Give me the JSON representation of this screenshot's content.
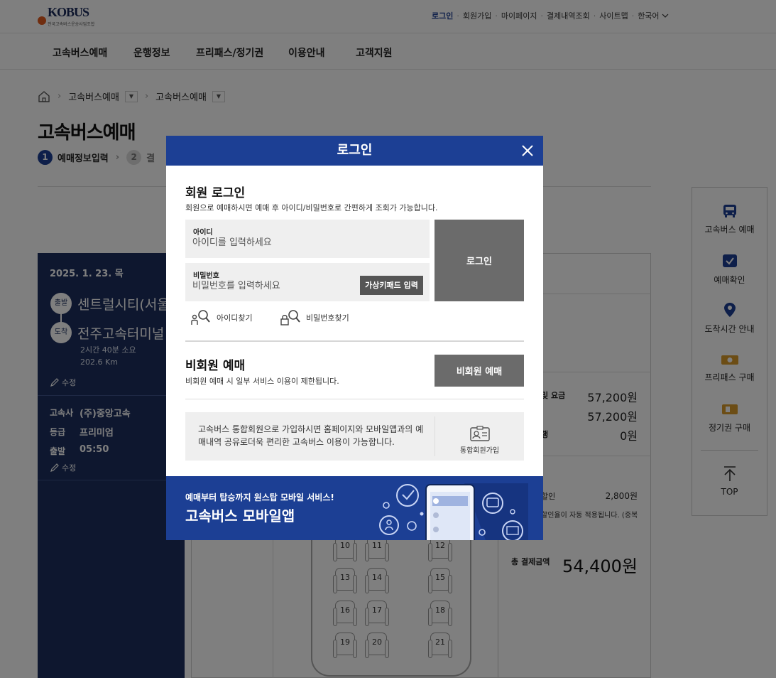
{
  "header": {
    "logo_text": "KOBUS",
    "logo_sub": "전국고속버스운송사업조합",
    "util_links": [
      "로그인",
      "회원가입",
      "마이페이지",
      "결제내역조회",
      "사이트맵",
      "한국어"
    ],
    "nav": [
      "고속버스예매",
      "운행정보",
      "프리패스/정기권",
      "이용안내",
      "고객지원"
    ]
  },
  "breadcrumb": {
    "items": [
      "고속버스예매",
      "고속버스예매"
    ]
  },
  "page": {
    "title": "고속버스예매"
  },
  "steps": [
    {
      "num": "1",
      "label": "예매정보입력"
    },
    {
      "num": "2",
      "label": "결"
    }
  ],
  "trip": {
    "date": "2025. 1. 23. 목",
    "depart_badge": "출발",
    "depart": "센트럴시티(서울",
    "arrive_badge": "도착",
    "arrive": "전주고속터미널",
    "duration": "2시간 40분 소요",
    "distance": "202.6 Km",
    "edit_label": "수정",
    "company_label": "고속사",
    "company": "(주)중앙고속",
    "grade_label": "등급",
    "grade": "프리미엄",
    "departure_time_label": "출발",
    "departure_time": "05:50"
  },
  "seats": [
    "10",
    "11",
    "12",
    "13",
    "14",
    "15",
    "16",
    "17",
    "18",
    "19",
    "20",
    "21"
  ],
  "fare": {
    "row1_label": "및 요금",
    "row1_value": "57,200원",
    "row2_value": "57,200원",
    "row3_label": "행",
    "row3_value": "0원",
    "discount_label": "할인",
    "discount_value": "2,800원",
    "discount_note": "할인율이 자동 적용됩니다. (중복",
    "total_label": "총 결제금액",
    "total_value": "54,400원"
  },
  "quick_menu": [
    {
      "label": "고속버스 예매",
      "icon": "bus-icon"
    },
    {
      "label": "예매확인",
      "icon": "ticket-check-icon"
    },
    {
      "label": "도착시간 안내",
      "icon": "location-pin-icon"
    },
    {
      "label": "프리패스 구매",
      "icon": "freepass-icon"
    },
    {
      "label": "정기권 구매",
      "icon": "season-ticket-icon"
    }
  ],
  "quick_top": "TOP",
  "modal": {
    "title": "로그인",
    "member_title": "회원 로그인",
    "member_desc": "회원으로 예매하시면 예매 후 아이디/비밀번호로 간편하게 조회가 가능합니다.",
    "id_label": "아이디",
    "id_placeholder": "아이디를 입력하세요",
    "pw_label": "비밀번호",
    "pw_placeholder": "비밀번호를 입력하세요",
    "virtual_keypad": "가상키패드 입력",
    "login_button": "로그인",
    "find_id": "아이디찾기",
    "find_pw": "비밀번호찾기",
    "guest_title": "비회원 예매",
    "guest_desc": "비회원 예매 시 일부 서비스 이용이 제한됩니다.",
    "guest_button": "비회원 예매",
    "promo_text": "고속버스 통합회원으로 가입하시면 홈페이지와 모바일앱과의 예매내역 공유로더욱 편리한 고속버스 이용이 가능합니다.",
    "join_label": "통합회원가입",
    "banner_sub": "예매부터 탑승까지 원스탑 모바일 서비스!",
    "banner_title": "고속버스 모바일앱"
  },
  "colors": {
    "primary": "#1c3f94",
    "panel": "#1c2f5e",
    "button_gray": "#6b6b6b"
  }
}
